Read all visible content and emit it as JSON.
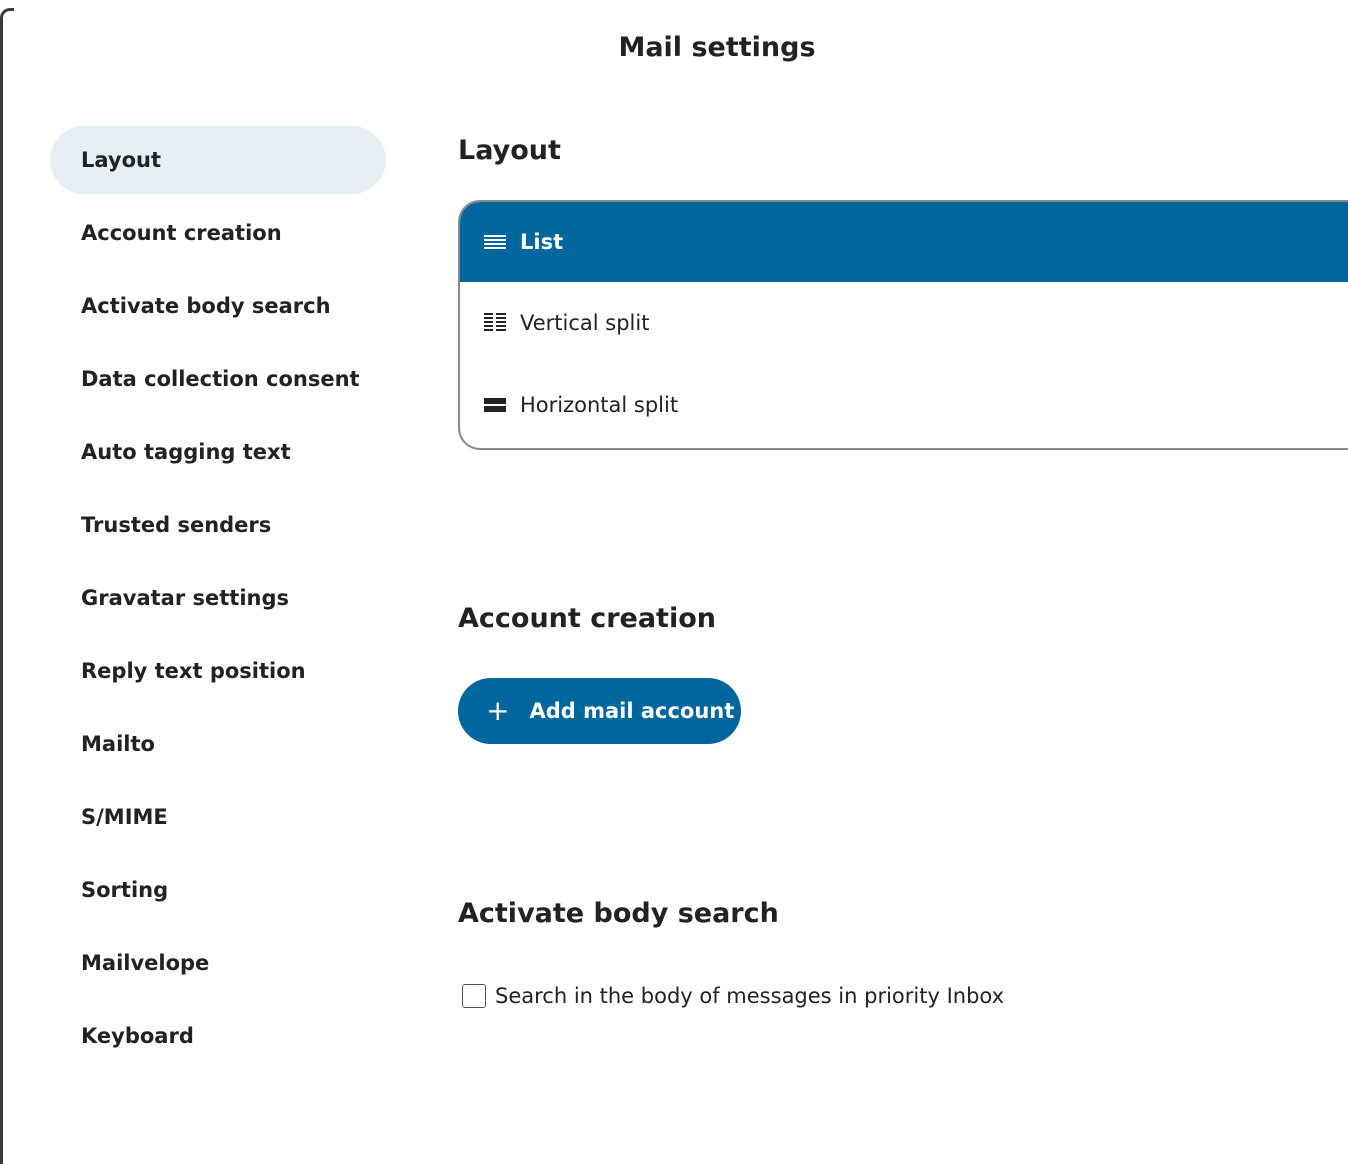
{
  "dialog": {
    "title": "Mail settings"
  },
  "sidebar": {
    "items": [
      {
        "label": "Layout",
        "active": true
      },
      {
        "label": "Account creation"
      },
      {
        "label": "Activate body search"
      },
      {
        "label": "Data collection consent"
      },
      {
        "label": "Auto tagging text"
      },
      {
        "label": "Trusted senders"
      },
      {
        "label": "Gravatar settings"
      },
      {
        "label": "Reply text position"
      },
      {
        "label": "Mailto"
      },
      {
        "label": "S/MIME"
      },
      {
        "label": "Sorting"
      },
      {
        "label": "Mailvelope"
      },
      {
        "label": "Keyboard"
      }
    ]
  },
  "layout_section": {
    "heading": "Layout",
    "options": [
      {
        "label": "List",
        "icon": "list-icon",
        "selected": true
      },
      {
        "label": "Vertical split",
        "icon": "vertical-split-icon"
      },
      {
        "label": "Horizontal split",
        "icon": "horizontal-split-icon"
      }
    ]
  },
  "account_section": {
    "heading": "Account creation",
    "button_label": "Add mail account",
    "button_icon": "plus-icon"
  },
  "body_search_section": {
    "heading": "Activate body search",
    "checkbox_label": "Search in the body of messages in priority Inbox",
    "checked": false
  },
  "colors": {
    "accent": "#00669e",
    "active_nav_bg": "#e6edf3",
    "text": "#222222"
  }
}
